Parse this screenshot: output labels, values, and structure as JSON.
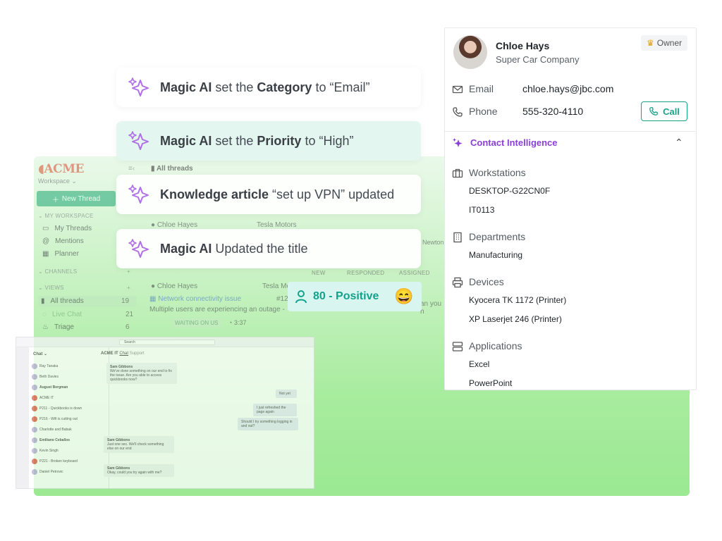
{
  "inbox": {
    "logo": "ACME",
    "workspace": "Workspace",
    "new_thread": "New Thread",
    "my_workspace": "MY WORKSPACE",
    "my_threads": "My Threads",
    "mentions": "Mentions",
    "planner": "Planner",
    "channels": "CHANNELS",
    "views": "VIEWS",
    "all_threads": "All threads",
    "all_threads_count": "19",
    "live_chat": "Live Chat",
    "live_chat_count": "21",
    "triage": "Triage",
    "triage_count": "6",
    "header_title": "All threads",
    "row1_name": "Chloe Hayes",
    "row1_company": "Tesla Motors",
    "row2_name": "Chloe Hayes",
    "row2_company": "Tesla Mo",
    "row2_subject": "Network connectivity issue",
    "row2_num": "#12",
    "row2_preview": "Multiple users are experiencing an outage -",
    "row2_badge": "WAITING ON US",
    "row2_time": "3:37",
    "col_new": "NEW",
    "col_responded": "RESPONDED",
    "col_assigned": "ASSIGNED",
    "partial_newton": "Newton",
    "partial_you": "an you h"
  },
  "ai_cards": [
    {
      "pre": "Magic AI",
      "mid": " set the ",
      "key": "Category",
      "post": " to “Email”"
    },
    {
      "pre": "Magic AI",
      "mid": " set the ",
      "key": "Priority",
      "post": " to “High”"
    },
    {
      "pre": "Knowledge article",
      "mid": " “set up VPN” updated",
      "key": "",
      "post": ""
    },
    {
      "pre": "Magic AI",
      "mid": " Updated the title",
      "key": "",
      "post": ""
    }
  ],
  "sentiment": {
    "label": "80 - Positive",
    "emoji": "😄"
  },
  "contact": {
    "name": "Chloe Hays",
    "company": "Super Car Company",
    "role": "Owner",
    "email_label": "Email",
    "email": "chloe.hays@jbc.com",
    "phone_label": "Phone",
    "phone": "555-320-4110",
    "call_label": "Call",
    "intelligence_title": "Contact Intelligence",
    "workstations_label": "Workstations",
    "workstations": [
      "DESKTOP-G22CN0F",
      "IT0113"
    ],
    "departments_label": "Departments",
    "departments": [
      "Manufacturing"
    ],
    "devices_label": "Devices",
    "devices": [
      "Kyocera TK 1172 (Printer)",
      "XP Laserjet 246 (Printer)"
    ],
    "applications_label": "Applications",
    "applications": [
      "Excel",
      "PowerPoint"
    ]
  },
  "teams": {
    "section": "Chat",
    "channel": "ACME IT",
    "tab1": "Chat",
    "tab2": "Support",
    "search": "Search",
    "chats": [
      "Ray Tanaka",
      "Beth Davies",
      "August Bergman",
      "ACME IT",
      "P211 - Quickbooks is down",
      "P216 - Wifi is cutting out",
      "Charlotte and Babak",
      "Emiliano Ceballos",
      "Kevin Singh",
      "P221 - Broken keyboard",
      "Daniel Petrovic"
    ],
    "sender": "Sam Gibbons",
    "msg1": "We've done something on our end to fix the issue. Are you able to access quickbooks now?",
    "msg2": "Not yet",
    "msg3": "I just refreshed the page again",
    "msg4": "Should I try something logging in and out?",
    "msg5": "Just one sec. We'll check something else on our end",
    "msg6": "Okay, could you try again with me?"
  },
  "colors": {
    "accent_teal": "#1aa289",
    "accent_purple": "#8a3fd8",
    "green": "#9be992",
    "acme_red": "#d94b2b"
  }
}
